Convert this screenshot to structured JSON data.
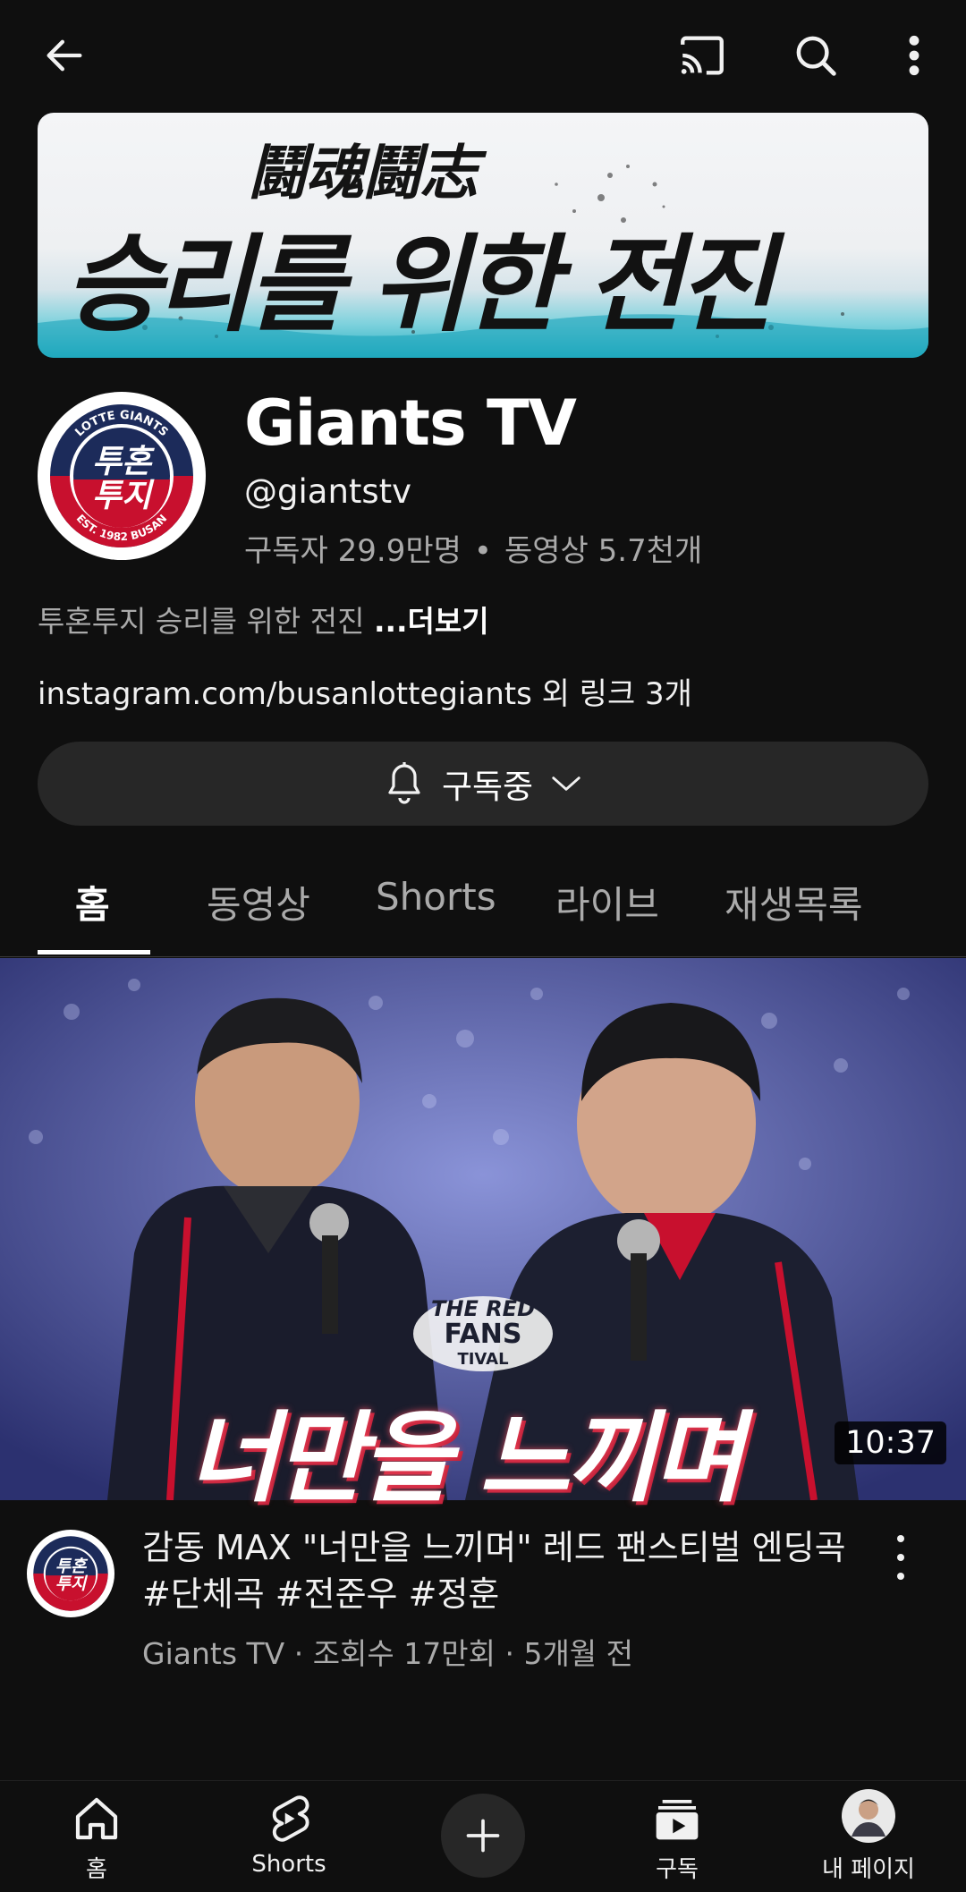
{
  "header": {
    "back_icon": "arrow-left-icon",
    "cast_icon": "cast-icon",
    "search_icon": "search-icon",
    "more_icon": "more-vertical-icon"
  },
  "banner": {
    "hanja": "鬪魂鬪志",
    "title": "승리를 위한 전진"
  },
  "channel": {
    "avatar_top": "LOTTE GIANTS",
    "avatar_main_line1": "투혼",
    "avatar_main_line2": "투지",
    "avatar_bottom": "EST. 1982 BUSAN",
    "name": "Giants TV",
    "handle": "@giantstv",
    "subscribers": "구독자 29.9만명",
    "stats_dot": "•",
    "videos": "동영상 5.7천개",
    "description": "투혼투지 승리를 위한 전진",
    "more_label": "...더보기",
    "links": "instagram.com/busanlottegiants 외 링크 3개",
    "subscribe_label": "구독중"
  },
  "tabs": [
    {
      "label": "홈",
      "active": true
    },
    {
      "label": "동영상",
      "active": false
    },
    {
      "label": "Shorts",
      "active": false
    },
    {
      "label": "라이브",
      "active": false
    },
    {
      "label": "재생목록",
      "active": false
    }
  ],
  "video": {
    "thumbnail_caption": "너만을 느끼며",
    "thumbnail_logo_line1": "THE RED",
    "thumbnail_logo_line2": "FANS",
    "thumbnail_logo_line3": "TIVAL",
    "duration": "10:37",
    "title": "감동 MAX \"너만을 느끼며\" 레드 팬스티벌 엔딩곡 #단체곡 #전준우 #정훈",
    "meta": "Giants TV · 조회수 17만회 · 5개월 전"
  },
  "bottom_nav": {
    "home": {
      "label": "홈",
      "icon": "home-icon"
    },
    "shorts": {
      "label": "Shorts",
      "icon": "shorts-icon"
    },
    "create": {
      "icon": "plus-icon"
    },
    "subscriptions": {
      "label": "구독",
      "icon": "subscriptions-icon"
    },
    "you": {
      "label": "내 페이지",
      "icon": "profile-avatar"
    }
  },
  "colors": {
    "background": "#0f0f0f",
    "surface": "#272727",
    "text_primary": "#f1f1f1",
    "text_secondary": "#aaaaaa",
    "giants_navy": "#1c2b5a",
    "giants_red": "#c8102e"
  }
}
